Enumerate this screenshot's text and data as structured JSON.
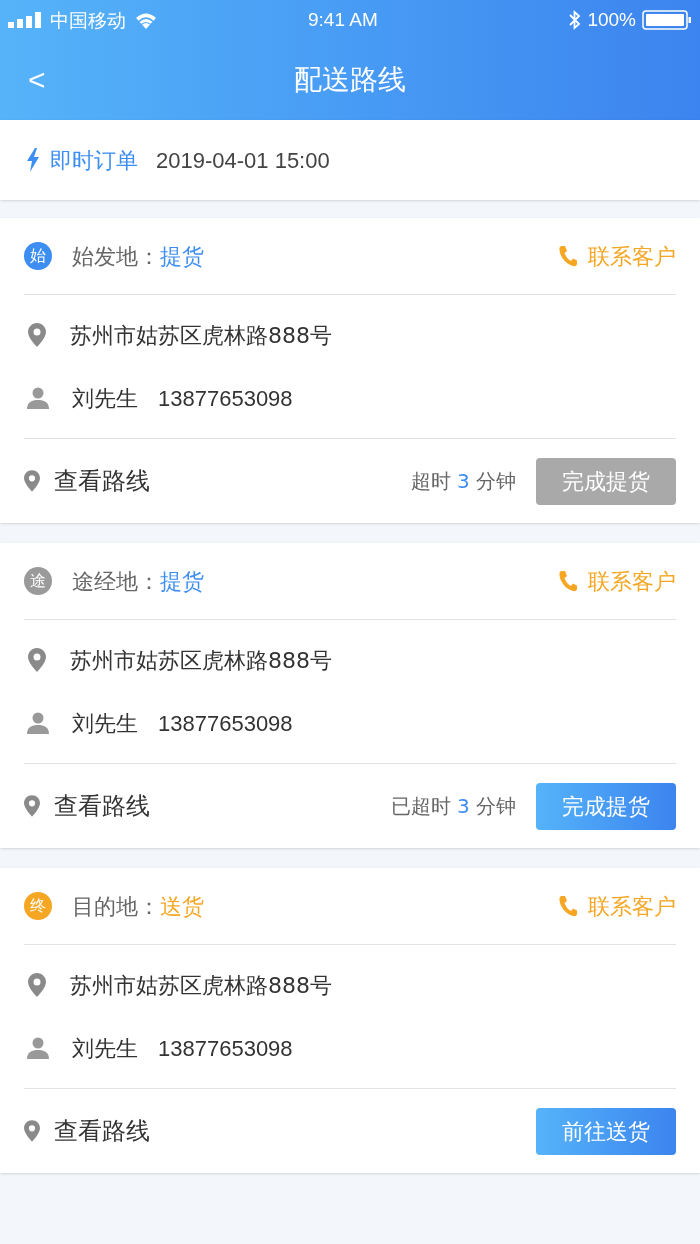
{
  "status_bar": {
    "carrier": "中国移动",
    "time": "9:41 AM",
    "battery": "100%"
  },
  "nav": {
    "back": "<",
    "title": "配送路线"
  },
  "order": {
    "type": "即时订单",
    "time": "2019-04-01 15:00"
  },
  "stops": [
    {
      "badge": "始",
      "color": "#3d8ef2",
      "label": "始发地：",
      "action": "提货",
      "kind": "pickup",
      "contact": "联系客户",
      "address": "苏州市姑苏区虎林路888号",
      "person": "刘先生",
      "phone": "13877653098",
      "route": "查看路线",
      "timeout": {
        "prefix": "超时",
        "minutes": "3",
        "suffix": "分钟"
      },
      "button": {
        "label": "完成提货",
        "disabled": true
      }
    },
    {
      "badge": "途",
      "color": "#9a9a9a",
      "label": "途经地：",
      "action": "提货",
      "kind": "pickup",
      "contact": "联系客户",
      "address": "苏州市姑苏区虎林路888号",
      "person": "刘先生",
      "phone": "13877653098",
      "route": "查看路线",
      "timeout": {
        "prefix": "已超时",
        "minutes": "3",
        "suffix": "分钟"
      },
      "button": {
        "label": "完成提货",
        "disabled": false
      }
    },
    {
      "badge": "终",
      "color": "#f5a623",
      "label": "目的地：",
      "action": "送货",
      "kind": "delivery",
      "contact": "联系客户",
      "address": "苏州市姑苏区虎林路888号",
      "person": "刘先生",
      "phone": "13877653098",
      "route": "查看路线",
      "button": {
        "label": "前往送货",
        "disabled": false
      }
    }
  ]
}
